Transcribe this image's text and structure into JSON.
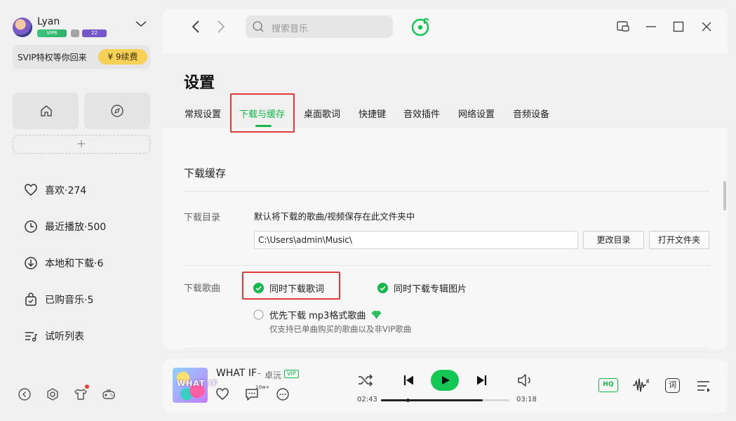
{
  "user": {
    "name": "Lyan",
    "vip_badge": "VIP6",
    "level_badge": "22",
    "svip_promo": "SVIP特权等你回来",
    "renew_label": "¥ 9续费"
  },
  "sidebar": {
    "add_symbol": "+",
    "items": [
      {
        "label": "喜欢·274",
        "icon": "heart-icon"
      },
      {
        "label": "最近播放·500",
        "icon": "clock-icon"
      },
      {
        "label": "本地和下载·6",
        "icon": "download-icon"
      },
      {
        "label": "已购音乐·5",
        "icon": "bag-icon"
      },
      {
        "label": "试听列表",
        "icon": "playlist-icon"
      }
    ]
  },
  "search": {
    "placeholder": "搜索音乐"
  },
  "settings": {
    "title": "设置",
    "tabs": [
      {
        "label": "常规设置",
        "active": false
      },
      {
        "label": "下载与缓存",
        "active": true
      },
      {
        "label": "桌面歌词",
        "active": false
      },
      {
        "label": "快捷键",
        "active": false
      },
      {
        "label": "音效插件",
        "active": false
      },
      {
        "label": "网络设置",
        "active": false
      },
      {
        "label": "音频设备",
        "active": false
      }
    ],
    "section_title": "下载缓存",
    "download_dir": {
      "label": "下载目录",
      "description": "默认将下载的歌曲/视频保存在此文件夹中",
      "path": "C:\\Users\\admin\\Music\\",
      "change_button": "更改目录",
      "open_button": "打开文件夹"
    },
    "download_song": {
      "label": "下载歌曲",
      "lyrics_option": {
        "label": "同时下载歌词",
        "checked": true
      },
      "cover_option": {
        "label": "同时下载专辑图片",
        "checked": true
      },
      "mp3_option": {
        "label": "优先下载 mp3格式歌曲",
        "checked": false
      },
      "mp3_note": "仅支持已单曲购买的歌曲以及非VIP歌曲"
    }
  },
  "player": {
    "cover_text": "WHAT IF",
    "title": "WHAT IF",
    "separator": "-",
    "artist": "卓沅",
    "vip_tag": "VIP",
    "comment_count": "10w+",
    "elapsed": "02:43",
    "duration": "03:18",
    "progress_fraction": 0.82,
    "quality_label": "HQ",
    "lyrics_label": "词"
  },
  "colors": {
    "accent": "#14b84a",
    "highlight_border": "#e03a3a",
    "renew_button": "#f7d155"
  }
}
